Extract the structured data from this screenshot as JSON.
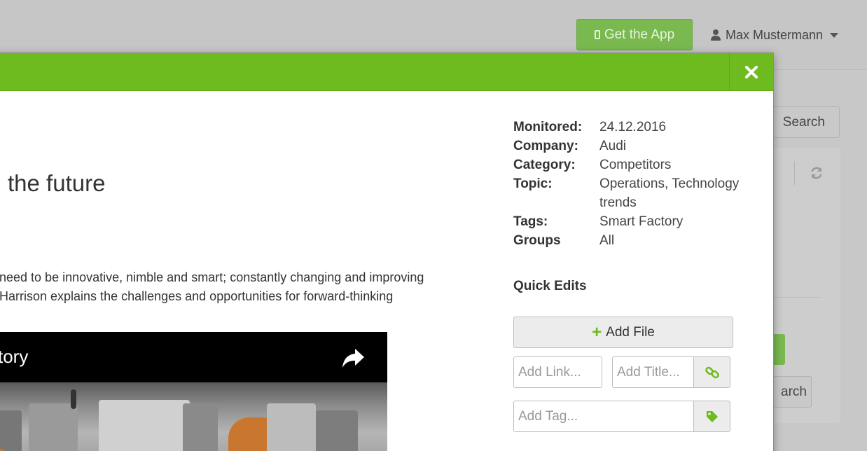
{
  "topbar": {
    "get_app_label": "Get the App",
    "user_name": "Max Mustermann"
  },
  "background": {
    "search_label": "Search",
    "search_label_2": "arch"
  },
  "modal": {
    "article": {
      "title": "the future",
      "text_lines": [
        "need to be innovative, nimble and smart; constantly changing and improving",
        "Harrison explains the challenges and opportunities for forward-thinking"
      ],
      "video_title": "ctory"
    },
    "meta": {
      "monitored_label": "Monitored:",
      "monitored_value": "24.12.2016",
      "company_label": "Company:",
      "company_value": "Audi",
      "category_label": "Category:",
      "category_value": "Competitors",
      "topic_label": "Topic:",
      "topic_value": "Operations, Technology trends",
      "tags_label": "Tags:",
      "tags_value": "Smart Factory",
      "groups_label": "Groups",
      "groups_value": "All"
    },
    "quick_edits": {
      "title": "Quick Edits",
      "add_file_label": "Add File",
      "add_link_placeholder": "Add Link...",
      "add_title_placeholder": "Add Title...",
      "add_tag_placeholder": "Add Tag..."
    }
  },
  "colors": {
    "header_green": "#6dbb1e",
    "get_app_green": "#79b94f",
    "overlay_gray": "#c8c8c8"
  },
  "icons": [
    "phone-icon",
    "user-icon",
    "caret-down-icon",
    "close-icon",
    "share-icon",
    "plus-icon",
    "link-icon",
    "tag-icon",
    "refresh-icon"
  ]
}
